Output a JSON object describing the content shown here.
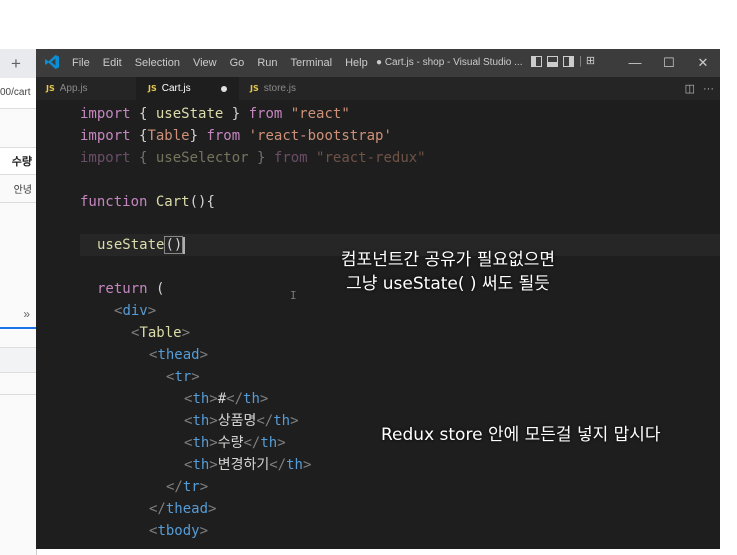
{
  "browser": {
    "new_tab": "+",
    "address_fragment": "00/cart",
    "table_header_cell": "수량",
    "table_cell": "안녕",
    "chevron": "»"
  },
  "window": {
    "menu": [
      "File",
      "Edit",
      "Selection",
      "View",
      "Go",
      "Run",
      "Terminal",
      "Help"
    ],
    "title": "● Cart.js - shop - Visual Studio ...",
    "separator": "|",
    "grid_glyph": "⊞",
    "controls": [
      "—",
      "☐",
      "✕"
    ]
  },
  "tabs": [
    {
      "icon": "JS",
      "label": "App.js"
    },
    {
      "icon": "JS",
      "label": "Cart.js"
    },
    {
      "icon": "JS",
      "label": "store.js"
    }
  ],
  "tab_actions": [
    "◫",
    "···"
  ],
  "code": {
    "l1": [
      "import",
      " { ",
      "useState",
      " } ",
      "from",
      " \"react\""
    ],
    "l2": [
      "import",
      " {",
      "Table",
      "} ",
      "from",
      " 'react-bootstrap'"
    ],
    "l3": [
      "import",
      " { ",
      "useSelector",
      " } ",
      "from",
      " \"react-redux\""
    ],
    "l4": [
      "function",
      " ",
      "Cart",
      "(){"
    ],
    "l5": [
      "useState",
      "()"
    ],
    "l6": [
      "return",
      " ("
    ],
    "l7": [
      "<",
      "div",
      ">"
    ],
    "l8": [
      "<",
      "Table",
      ">"
    ],
    "l9": [
      "<",
      "thead",
      ">"
    ],
    "l10": [
      "<",
      "tr",
      ">"
    ],
    "l11": [
      "<",
      "th",
      ">",
      "#",
      "</",
      "th",
      ">"
    ],
    "l12": [
      "<",
      "th",
      ">",
      "상품명",
      "</",
      "th",
      ">"
    ],
    "l13": [
      "<",
      "th",
      ">",
      "수량",
      "</",
      "th",
      ">"
    ],
    "l14": [
      "<",
      "th",
      ">",
      "변경하기",
      "</",
      "th",
      ">"
    ],
    "l15": [
      "</",
      "tr",
      ">"
    ],
    "l16": [
      "</",
      "thead",
      ">"
    ],
    "l17": [
      "<",
      "tbody",
      ">"
    ]
  },
  "captions": {
    "c1_line1": "컴포넌트간 공유가 필요없으면",
    "c1_line2": "그냥 useState( ) 써도 될듯",
    "c2": "Redux store 안에 모든걸 넣지 맙시다"
  },
  "ibeam": "I",
  "colors": {
    "keyword": "#c586c0",
    "function": "#dcdcaa",
    "string": "#ce9178",
    "tag": "#569cd6",
    "accent": "#0078d4"
  }
}
